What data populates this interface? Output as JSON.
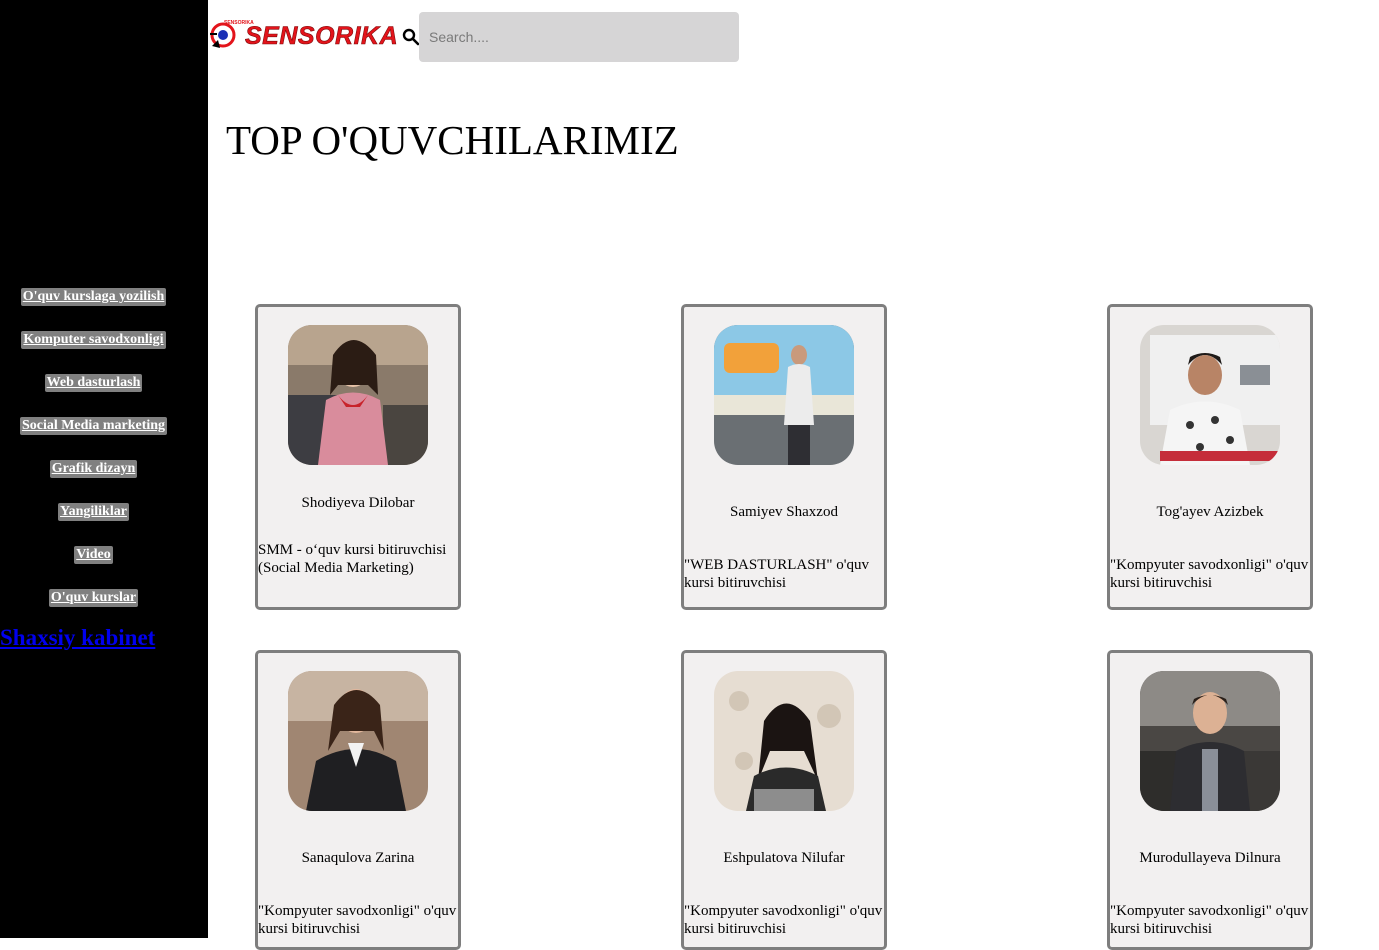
{
  "header": {
    "logo_text": "SENSORIKA",
    "search_placeholder": "Search...."
  },
  "sidebar": {
    "items": [
      {
        "label": "O'quv kurslaga yozilish"
      },
      {
        "label": "Komputer savodxonligi"
      },
      {
        "label": "Web dasturlash"
      },
      {
        "label": "Social Media marketing"
      },
      {
        "label": "Grafik dizayn"
      },
      {
        "label": "Yangiliklar"
      },
      {
        "label": "Video"
      },
      {
        "label": "O'quv kurslar"
      }
    ],
    "cabinet_link": "Shaxsiy kabinet"
  },
  "main": {
    "title": "TOP O'QUVCHILARIMIZ",
    "students": [
      {
        "name": "Shodiyeva Dilobar",
        "desc": "SMM - o‘quv kursi bitiruvchisi (Social Media Marketing)"
      },
      {
        "name": "Samiyev Shaxzod",
        "desc": "\"WEB DASTURLASH\" o'quv kursi bitiruvchisi"
      },
      {
        "name": "Tog'ayev Azizbek",
        "desc": "\"Kompyuter savodxonligi\" o'quv kursi bitiruvchisi"
      },
      {
        "name": "Sanaqulova Zarina",
        "desc": "\"Kompyuter savodxonligi\" o'quv kursi bitiruvchisi"
      },
      {
        "name": "Eshpulatova Nilufar",
        "desc": "\"Kompyuter savodxonligi\" o'quv kursi bitiruvchisi"
      },
      {
        "name": "Murodullayeva Dilnura",
        "desc": "\"Kompyuter savodxonligi\" o'quv kursi bitiruvchisi"
      }
    ]
  },
  "colors": {
    "sidebar_bg": "#000000",
    "nav_button_bg": "#808080",
    "card_bg": "#f2f0f0",
    "card_border": "#7e7e7e",
    "search_bg": "#d6d5d6",
    "logo_red": "#e3141b",
    "link_blue": "#0000ee"
  }
}
